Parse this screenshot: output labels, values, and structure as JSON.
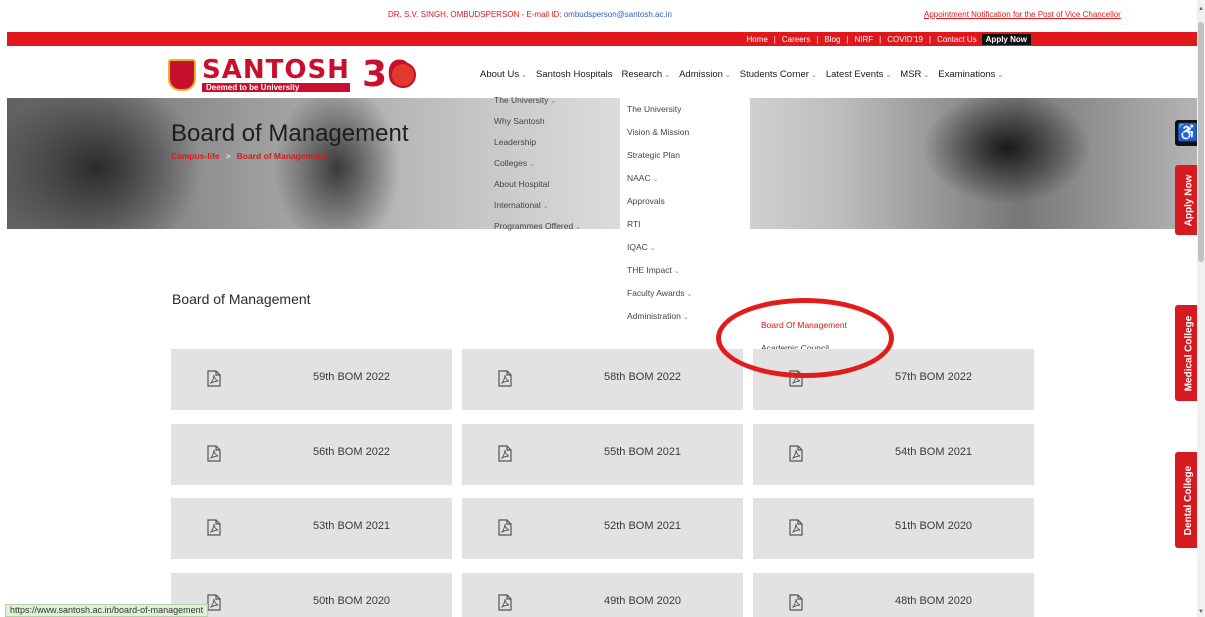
{
  "topline": {
    "ombudsman": "DR. S.V. SINGH, OMBUDSPERSON - E-mail ID: ",
    "ombudsman_email": "ombudsperson@santosh.ac.in",
    "appointment": "Appointment Notification for the Post of Vice Chancellor"
  },
  "utility": {
    "links": [
      "Home",
      "Careers",
      "Blog",
      "NIRF",
      "COVID'19",
      "Contact Us"
    ],
    "apply": "Apply Now"
  },
  "brand": {
    "name": "SANTOSH",
    "tagline": "Deemed to be University",
    "anniversary": "30"
  },
  "nav": [
    {
      "label": "About Us",
      "chevron": true
    },
    {
      "label": "Santosh Hospitals",
      "chevron": false
    },
    {
      "label": "Research",
      "chevron": true
    },
    {
      "label": "Admission",
      "chevron": true
    },
    {
      "label": "Students Corner",
      "chevron": true
    },
    {
      "label": "Latest Events",
      "chevron": true
    },
    {
      "label": "MSR",
      "chevron": true
    },
    {
      "label": "Examinations",
      "chevron": true
    }
  ],
  "hero": {
    "title": "Board of Management",
    "breadcrumb": [
      "Campus-life",
      "Board of Management"
    ]
  },
  "dropdown_left": [
    {
      "label": "The University",
      "chevron": true
    },
    {
      "label": "Why Santosh",
      "chevron": false
    },
    {
      "label": "Leadership",
      "chevron": false
    },
    {
      "label": "Colleges",
      "chevron": true
    },
    {
      "label": "About Hospital",
      "chevron": false
    },
    {
      "label": "International",
      "chevron": true
    },
    {
      "label": "Programmes Offered",
      "chevron": true
    }
  ],
  "dropdown_right": [
    {
      "label": "The University",
      "chevron": false
    },
    {
      "label": "Vision & Mission",
      "chevron": false
    },
    {
      "label": "Strategic Plan",
      "chevron": false
    },
    {
      "label": "NAAC",
      "chevron": true
    },
    {
      "label": "Approvals",
      "chevron": false
    },
    {
      "label": "RTI",
      "chevron": false
    },
    {
      "label": "IQAC",
      "chevron": true
    },
    {
      "label": "THE Impact",
      "chevron": true
    },
    {
      "label": "Faculty Awards",
      "chevron": true
    },
    {
      "label": "Administration",
      "chevron": true
    }
  ],
  "submenu": [
    "Board Of Management",
    "Academic Council"
  ],
  "section_title": "Board of Management",
  "documents": [
    "59th BOM 2022",
    "58th BOM 2022",
    "57th BOM 2022",
    "56th BOM 2022",
    "55th BOM 2021",
    "54th BOM 2021",
    "53th BOM 2021",
    "52th BOM 2021",
    "51th BOM 2020",
    "50th BOM 2020",
    "49th BOM 2020",
    "48th BOM 2020"
  ],
  "side_tabs": {
    "apply": "Apply Now",
    "medical": "Medical College",
    "dental": "Dental College"
  },
  "status_url": "https://www.santosh.ac.in/board-of-management",
  "colors": {
    "brand_red": "#e0181c",
    "card_bg": "#e2e2e2"
  }
}
